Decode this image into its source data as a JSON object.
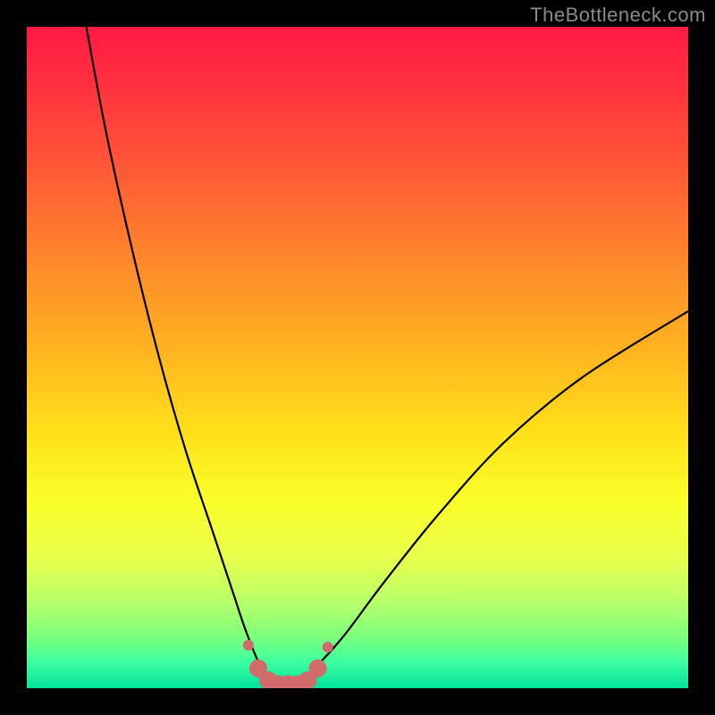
{
  "watermark": "TheBottleneck.com",
  "chart_data": {
    "type": "line",
    "title": "",
    "xlabel": "",
    "ylabel": "",
    "xlim": [
      0,
      100
    ],
    "ylim": [
      0,
      100
    ],
    "grid": false,
    "series": [
      {
        "name": "bottleneck-curve",
        "color": "#000000",
        "x": [
          9,
          12,
          16,
          20,
          24,
          28,
          31,
          33,
          35,
          36.5,
          38,
          40,
          42,
          44,
          48,
          54,
          62,
          72,
          84,
          100
        ],
        "y": [
          100,
          84,
          66,
          50,
          36,
          24,
          15,
          9,
          4,
          1.5,
          0.5,
          0.5,
          1.5,
          3.5,
          8,
          16,
          26,
          37,
          47,
          57
        ]
      },
      {
        "name": "highlight-dots",
        "color": "#d16a6a",
        "x": [
          33.5,
          35,
          36.5,
          38,
          39.5,
          41,
          42.5,
          44,
          45.5
        ],
        "y": [
          6.5,
          3,
          1.2,
          0.6,
          0.6,
          0.6,
          1.2,
          3,
          6.2
        ]
      }
    ]
  },
  "colors": {
    "curve": "#000000",
    "highlight": "#d16a6a",
    "watermark": "#8a8a8a"
  }
}
